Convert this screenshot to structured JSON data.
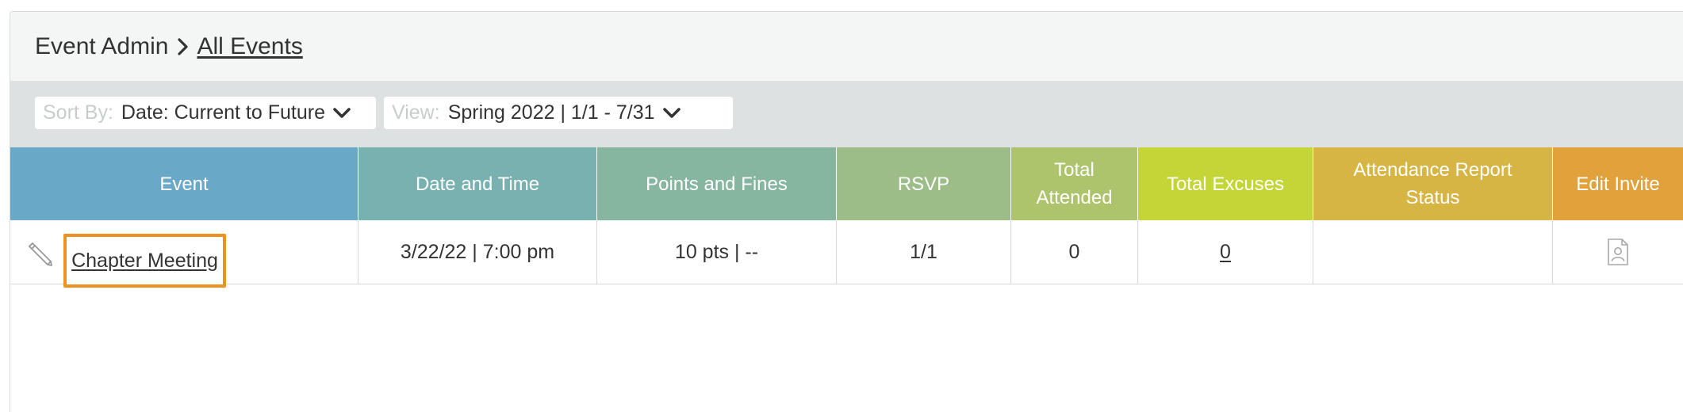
{
  "breadcrumb": {
    "parent": "Event Admin",
    "current": "All Events"
  },
  "filters": {
    "sort": {
      "label": "Sort By:",
      "value": "Date: Current to Future"
    },
    "view": {
      "label": "View:",
      "value": "Spring 2022 | 1/1 - 7/31"
    }
  },
  "table": {
    "columns": [
      {
        "label": "Event",
        "color": "#69a9c7"
      },
      {
        "label": "Date and Time",
        "color": "#79b1b0"
      },
      {
        "label": "Points and Fines",
        "color": "#86b5a0"
      },
      {
        "label": "RSVP",
        "color": "#9cbd88"
      },
      {
        "label": "Total Attended",
        "color": "#adc46d"
      },
      {
        "label": "Total Excuses",
        "color": "#c3d636"
      },
      {
        "label": "Attendance Report Status",
        "color": "#d6b544"
      },
      {
        "label": "Edit Invite",
        "color": "#e2a23b"
      }
    ],
    "rows": [
      {
        "event": "Chapter Meeting",
        "datetime": "3/22/22 | 7:00 pm",
        "points_fines": "10 pts | --",
        "rsvp": "1/1",
        "total_attended": "0",
        "total_excuses": "0",
        "attendance_status": "",
        "edit_invite_icon": "contact-card-icon"
      }
    ]
  },
  "colors": {
    "highlight": "#f0901e",
    "header_bg": "#f4f5f5",
    "filter_bar_bg": "#dee1e2"
  }
}
